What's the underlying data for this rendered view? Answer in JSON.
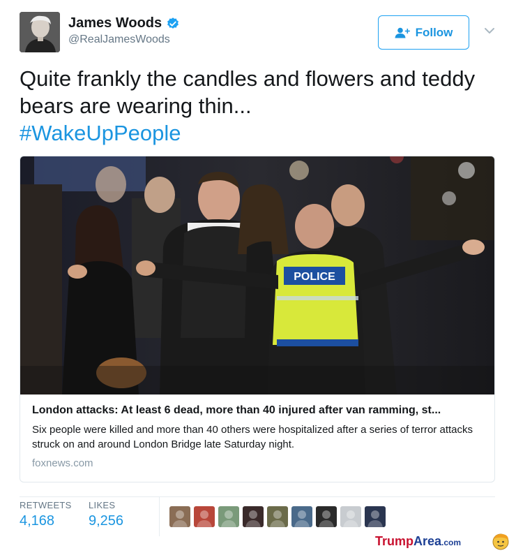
{
  "user": {
    "name": "James Woods",
    "handle": "@RealJamesWoods",
    "follow_label": "Follow"
  },
  "tweet": {
    "text": "Quite frankly the candles and flowers and teddy bears are wearing thin...",
    "hashtag": "#WakeUpPeople"
  },
  "card": {
    "image_sign": "POLICE",
    "title": "London attacks: At least 6 dead, more than 40 injured after van ramming, st...",
    "description": "Six people were killed and more than 40 others were hospitalized after a series of terror attacks struck on and around London Bridge late Saturday night.",
    "domain": "foxnews.com"
  },
  "stats": {
    "retweets_label": "RETWEETS",
    "retweets_value": "4,168",
    "likes_label": "LIKES",
    "likes_value": "9,256"
  },
  "likers": [
    {
      "color": "#8a6d55"
    },
    {
      "color": "#b8473a"
    },
    {
      "color": "#7a9a7a"
    },
    {
      "color": "#3a2a2a"
    },
    {
      "color": "#6b6b4a"
    },
    {
      "color": "#4a6a8a"
    },
    {
      "color": "#2a2a2a"
    },
    {
      "color": "#c8ccd0"
    },
    {
      "color": "#2a3550"
    }
  ],
  "watermark": {
    "trump": "Trump",
    "area": "Area",
    "com": ".com"
  },
  "colors": {
    "accent": "#1b95e0",
    "verified": "#1da1f2",
    "muted": "#657786"
  }
}
